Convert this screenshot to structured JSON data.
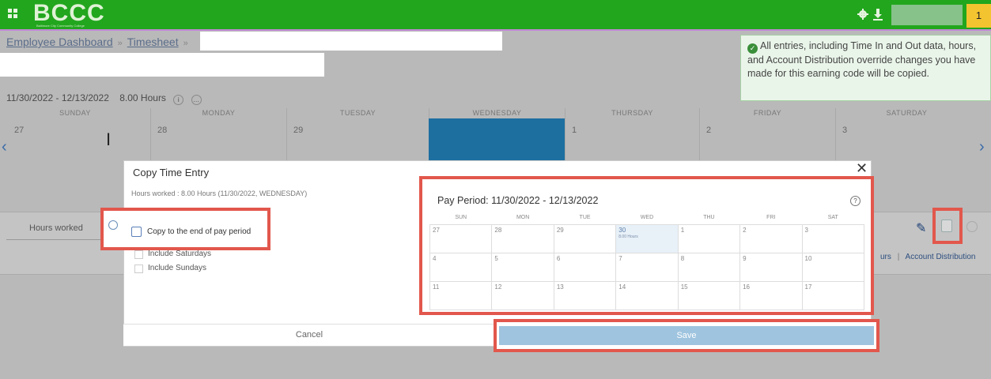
{
  "header": {
    "logo": "BCCC",
    "logo_sub": "Baltimore City Community College",
    "gear_icon": "gear-icon",
    "download_icon": "download-icon",
    "notification_count": "1"
  },
  "breadcrumb": {
    "items": [
      "Employee Dashboard",
      "Timesheet"
    ]
  },
  "toast": {
    "icon": "check-circle-icon",
    "message": "All entries, including Time In and Out data, hours, and Account Distribution override changes you have made for this earning code will be copied."
  },
  "week": {
    "range": "11/30/2022 - 12/13/2022",
    "hours": "8.00 Hours",
    "days": [
      {
        "name": "SUNDAY",
        "num": "27"
      },
      {
        "name": "MONDAY",
        "num": "28"
      },
      {
        "name": "TUESDAY",
        "num": "29"
      },
      {
        "name": "WEDNESDAY",
        "num": ""
      },
      {
        "name": "THURSDAY",
        "num": "1"
      },
      {
        "name": "FRIDAY",
        "num": "2"
      },
      {
        "name": "SATURDAY",
        "num": "3"
      }
    ]
  },
  "row": {
    "label": "Hours worked",
    "links": [
      "urs",
      "Account Distribution"
    ]
  },
  "modal": {
    "title": "Copy Time Entry",
    "info": "Hours worked : 8.00 Hours (11/30/2022, WEDNESDAY)",
    "copy_label": "Copy to the end of pay period",
    "include_saturdays": "Include Saturdays",
    "include_sundays": "Include Sundays",
    "cancel": "Cancel",
    "save": "Save"
  },
  "calendar": {
    "title": "Pay Period: 11/30/2022 - 12/13/2022",
    "weekdays": [
      "SUN",
      "MON",
      "TUE",
      "WED",
      "THU",
      "FRI",
      "SAT"
    ],
    "weeks": [
      [
        "27",
        "28",
        "29",
        "30",
        "1",
        "2",
        "3"
      ],
      [
        "4",
        "5",
        "6",
        "7",
        "8",
        "9",
        "10"
      ],
      [
        "11",
        "12",
        "13",
        "14",
        "15",
        "16",
        "17"
      ]
    ],
    "today_sub": "8.00 Hours"
  }
}
